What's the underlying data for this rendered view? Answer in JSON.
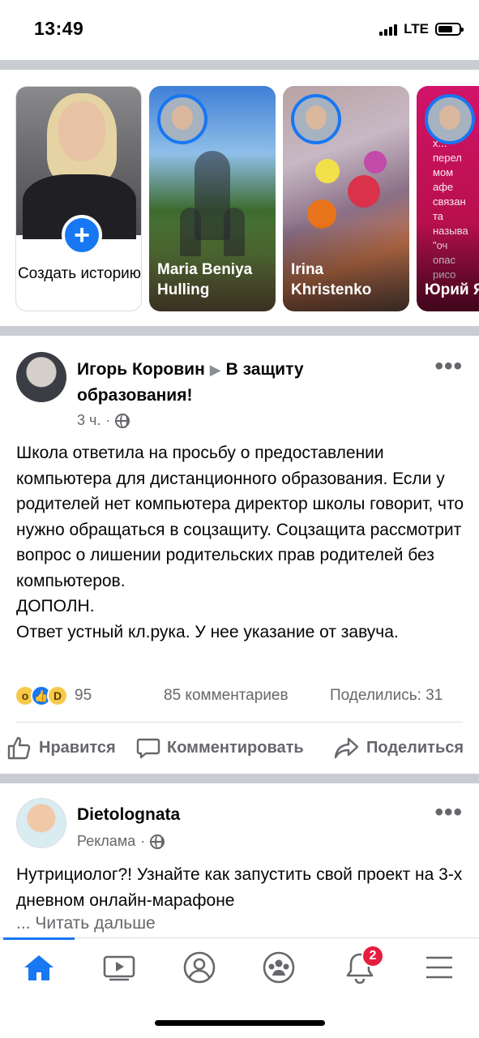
{
  "status_bar": {
    "time": "13:49",
    "network": "LTE"
  },
  "stories": {
    "create": {
      "label": "Создать историю"
    },
    "items": [
      {
        "name": "Maria Beniya Hulling"
      },
      {
        "name": "Irina Khristenko"
      },
      {
        "name": "Юрий Якимо",
        "overlay_text": "х...\nперел\nмом\nафе\nсвязан\nта\nназыва\n\"оч\nопас\nрисо"
      }
    ]
  },
  "post": {
    "author": "Игорь Коровин",
    "group": "В защиту образования!",
    "time": "3 ч.",
    "text": "Школа ответила на просьбу о предоставлении компьютера для дистанционного образования. Если у родителей нет компьютера директор школы говорит, что нужно обращаться в соцзащиту. Соцзащита рассмотрит вопрос о лишении родительских прав родителей без компьютеров.",
    "text_extra_1": "ДОПОЛН.",
    "text_extra_2": "Ответ устный кл.рука. У нее указание от завуча.",
    "reactions_count": "95",
    "comments": "85 комментариев",
    "shares": "Поделились: 31",
    "actions": {
      "like": "Нравится",
      "comment": "Комментировать",
      "share": "Поделиться"
    }
  },
  "ad": {
    "author": "Dietolognata",
    "label": "Реклама",
    "text": "Нутрициолог?! Узнайте как запустить свой проект на 3-х дневном онлайн-марафоне",
    "ellipsis": "...",
    "read_more": "Читать дальше"
  },
  "tabbar": {
    "icons": [
      "home-icon",
      "video-icon",
      "profile-icon",
      "groups-icon",
      "bell-icon",
      "menu-icon"
    ],
    "notifications_badge": "2",
    "accent": "#1877f2"
  }
}
